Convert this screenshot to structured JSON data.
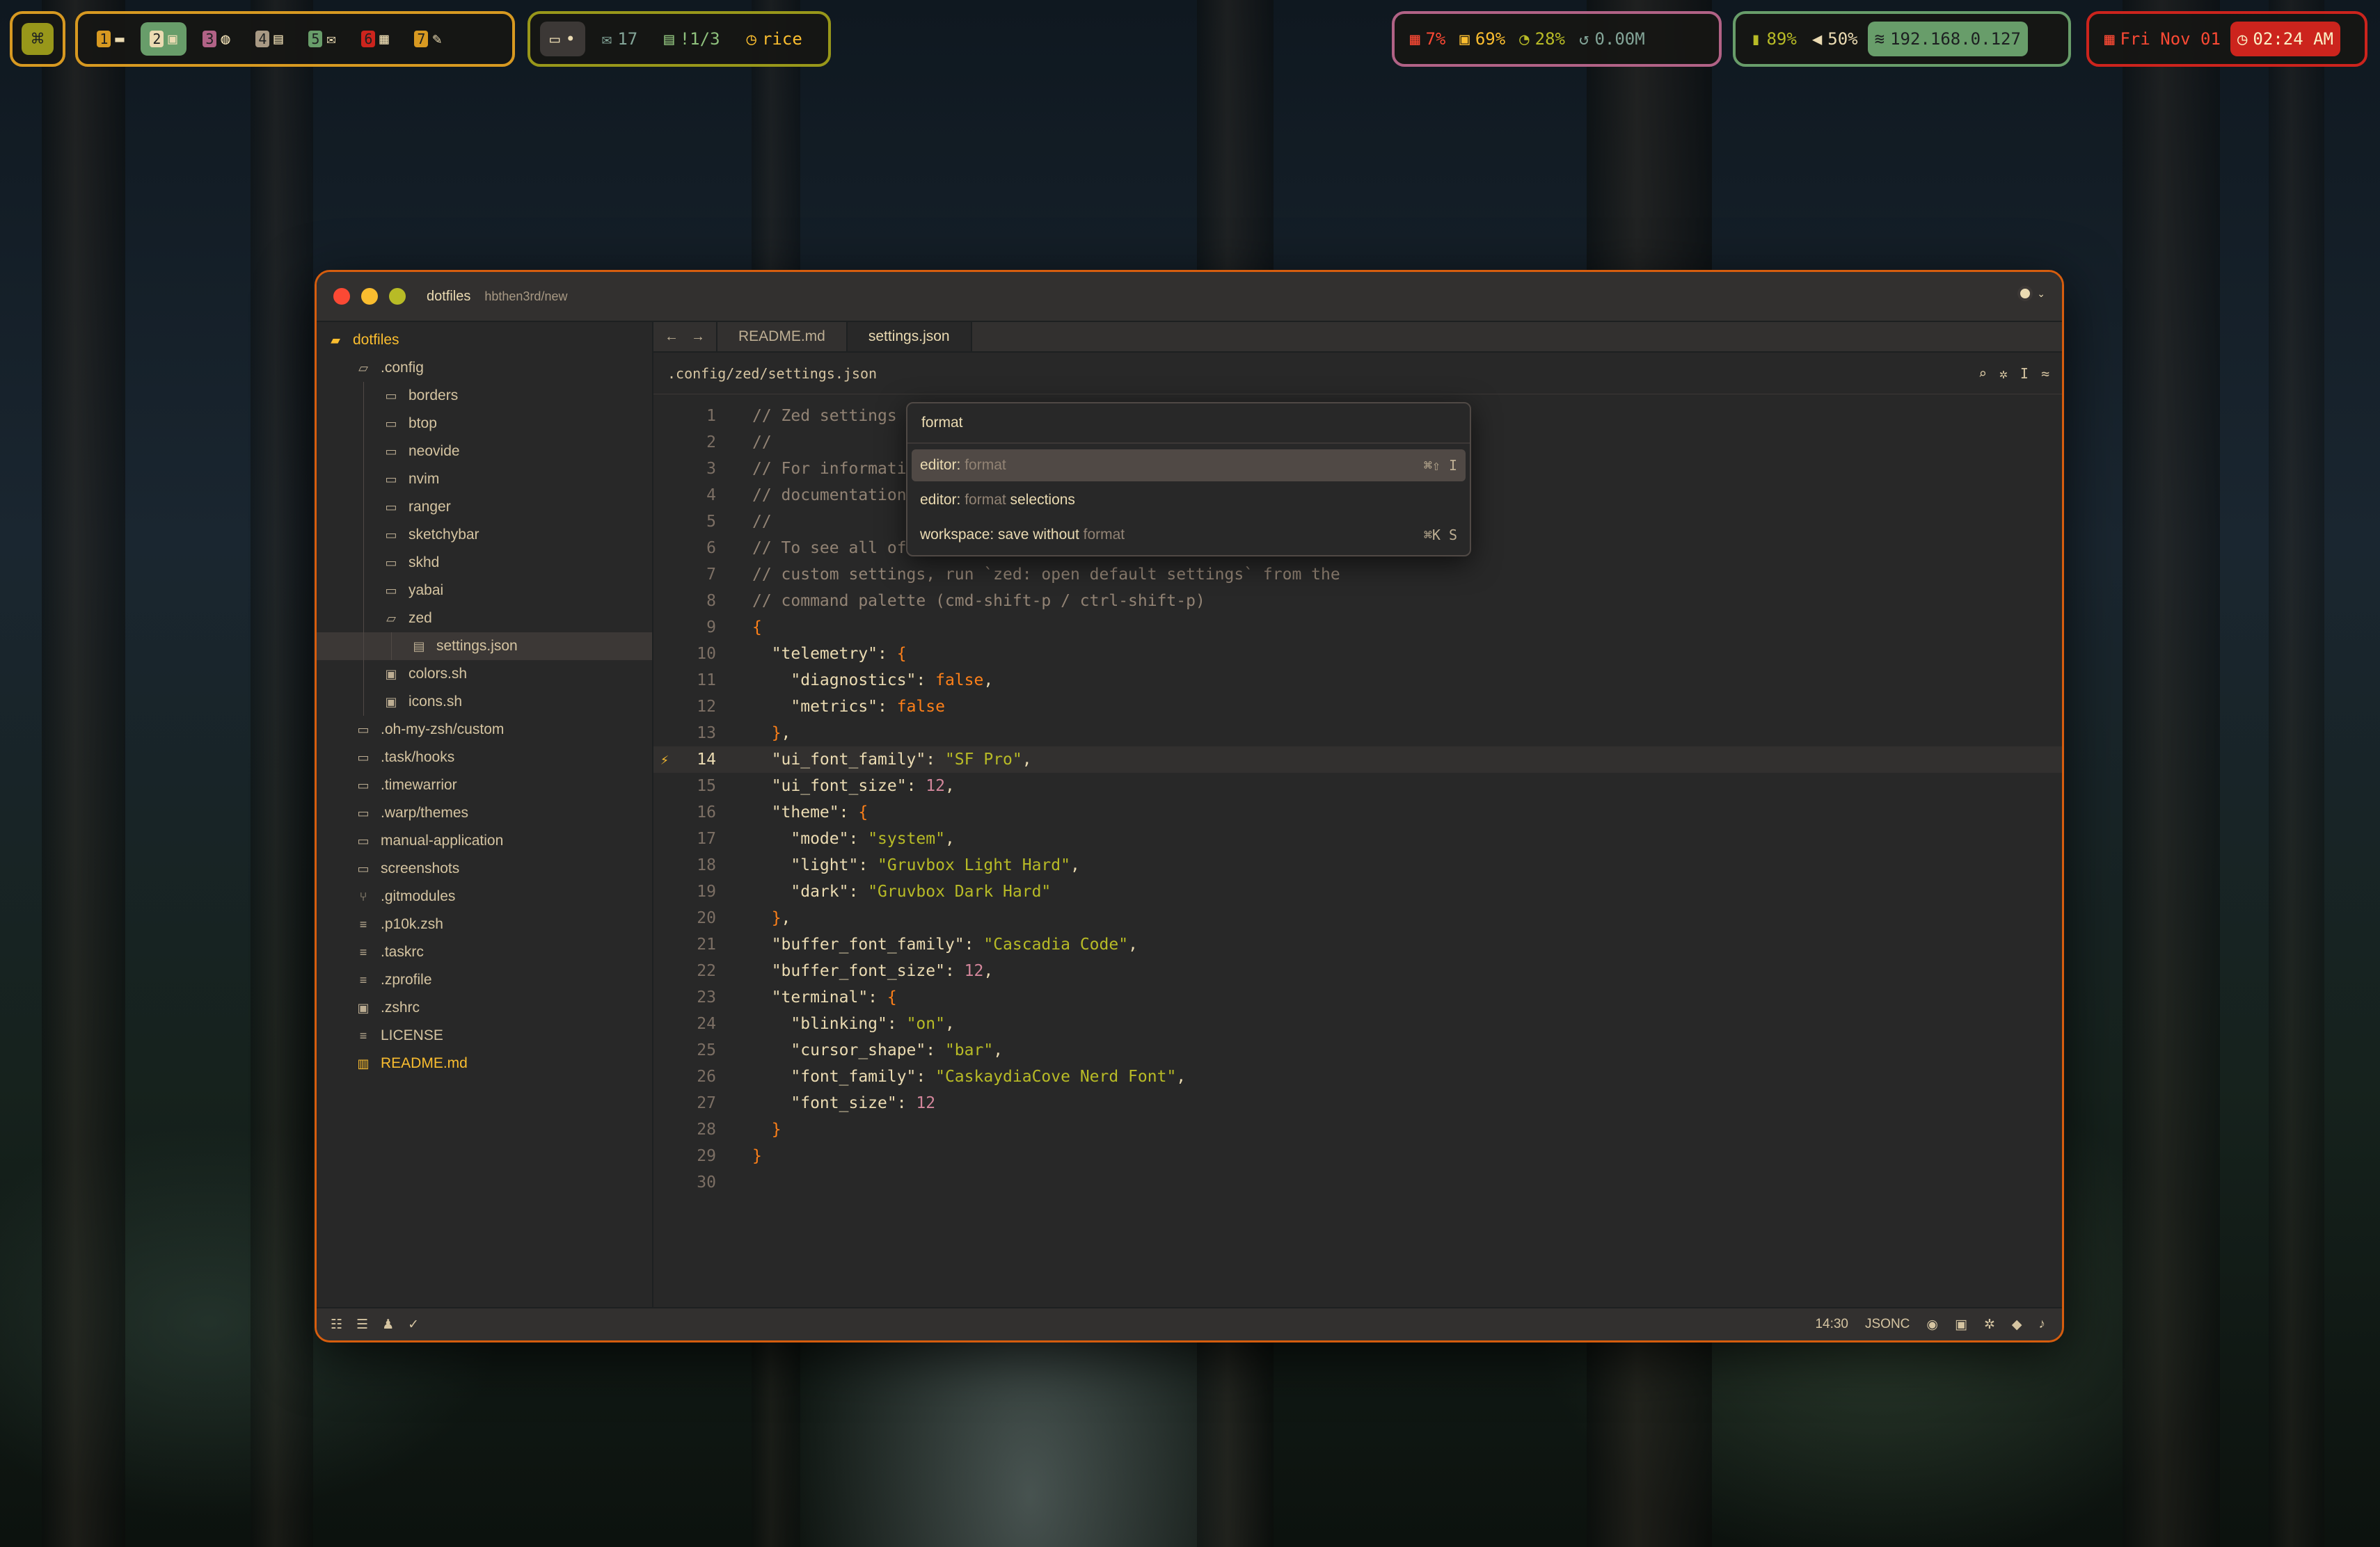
{
  "topbar": {
    "logo_icon": "command-key-icon",
    "workspaces": [
      {
        "num": "1",
        "icon": "folder-icon",
        "glyph": "▬"
      },
      {
        "num": "2",
        "icon": "window-icon",
        "glyph": "▣",
        "active": true
      },
      {
        "num": "3",
        "icon": "globe-icon",
        "glyph": "◍"
      },
      {
        "num": "4",
        "icon": "chat-icon",
        "glyph": "▤"
      },
      {
        "num": "5",
        "icon": "mail-icon",
        "glyph": "✉"
      },
      {
        "num": "6",
        "icon": "calendar-icon",
        "glyph": "▦"
      },
      {
        "num": "7",
        "icon": "edit-icon",
        "glyph": "✎"
      }
    ],
    "messages_dot": "•",
    "mail_count": "17",
    "tasks": "!1/3",
    "timer": "rice",
    "cpu": "7%",
    "memory": "69%",
    "disk": "28%",
    "network_rate": "0.00M",
    "battery": "89%",
    "volume": "50%",
    "ip": "192.168.0.127",
    "date": "Fri Nov 01",
    "time": "02:24 AM"
  },
  "window": {
    "project": "dotfiles",
    "branch": "hbthen3rd/new",
    "sidebar": {
      "root": "dotfiles",
      "items": [
        {
          "label": ".config",
          "type": "folder-open"
        },
        {
          "label": "borders",
          "type": "folder"
        },
        {
          "label": "btop",
          "type": "folder"
        },
        {
          "label": "neovide",
          "type": "folder"
        },
        {
          "label": "nvim",
          "type": "folder"
        },
        {
          "label": "ranger",
          "type": "folder"
        },
        {
          "label": "sketchybar",
          "type": "folder"
        },
        {
          "label": "skhd",
          "type": "folder"
        },
        {
          "label": "yabai",
          "type": "folder"
        },
        {
          "label": "zed",
          "type": "folder-open"
        },
        {
          "label": "settings.json",
          "type": "json"
        },
        {
          "label": "colors.sh",
          "type": "shell"
        },
        {
          "label": "icons.sh",
          "type": "shell"
        },
        {
          "label": ".oh-my-zsh/custom",
          "type": "folder"
        },
        {
          "label": ".task/hooks",
          "type": "folder"
        },
        {
          "label": ".timewarrior",
          "type": "folder"
        },
        {
          "label": ".warp/themes",
          "type": "folder"
        },
        {
          "label": "manual-application",
          "type": "folder"
        },
        {
          "label": "screenshots",
          "type": "folder"
        },
        {
          "label": ".gitmodules",
          "type": "git"
        },
        {
          "label": ".p10k.zsh",
          "type": "text"
        },
        {
          "label": ".taskrc",
          "type": "text"
        },
        {
          "label": ".zprofile",
          "type": "text"
        },
        {
          "label": ".zshrc",
          "type": "shell"
        },
        {
          "label": "LICENSE",
          "type": "text"
        },
        {
          "label": "README.md",
          "type": "book"
        }
      ]
    },
    "tabs": [
      {
        "label": "README.md"
      },
      {
        "label": "settings.json",
        "active": true
      }
    ],
    "breadcrumb": ".config/zed/settings.json",
    "palette": {
      "query": "format",
      "items": [
        {
          "prefix": "editor: ",
          "match": "format",
          "suffix": "",
          "keys": "⌘⇧ I"
        },
        {
          "prefix": "editor: ",
          "match": "format",
          "suffix": " selections",
          "keys": ""
        },
        {
          "prefix": "workspace: save without ",
          "match": "format",
          "suffix": "",
          "keys": "⌘K S"
        }
      ]
    },
    "status": {
      "cursor": "14:30",
      "language": "JSONC"
    }
  }
}
